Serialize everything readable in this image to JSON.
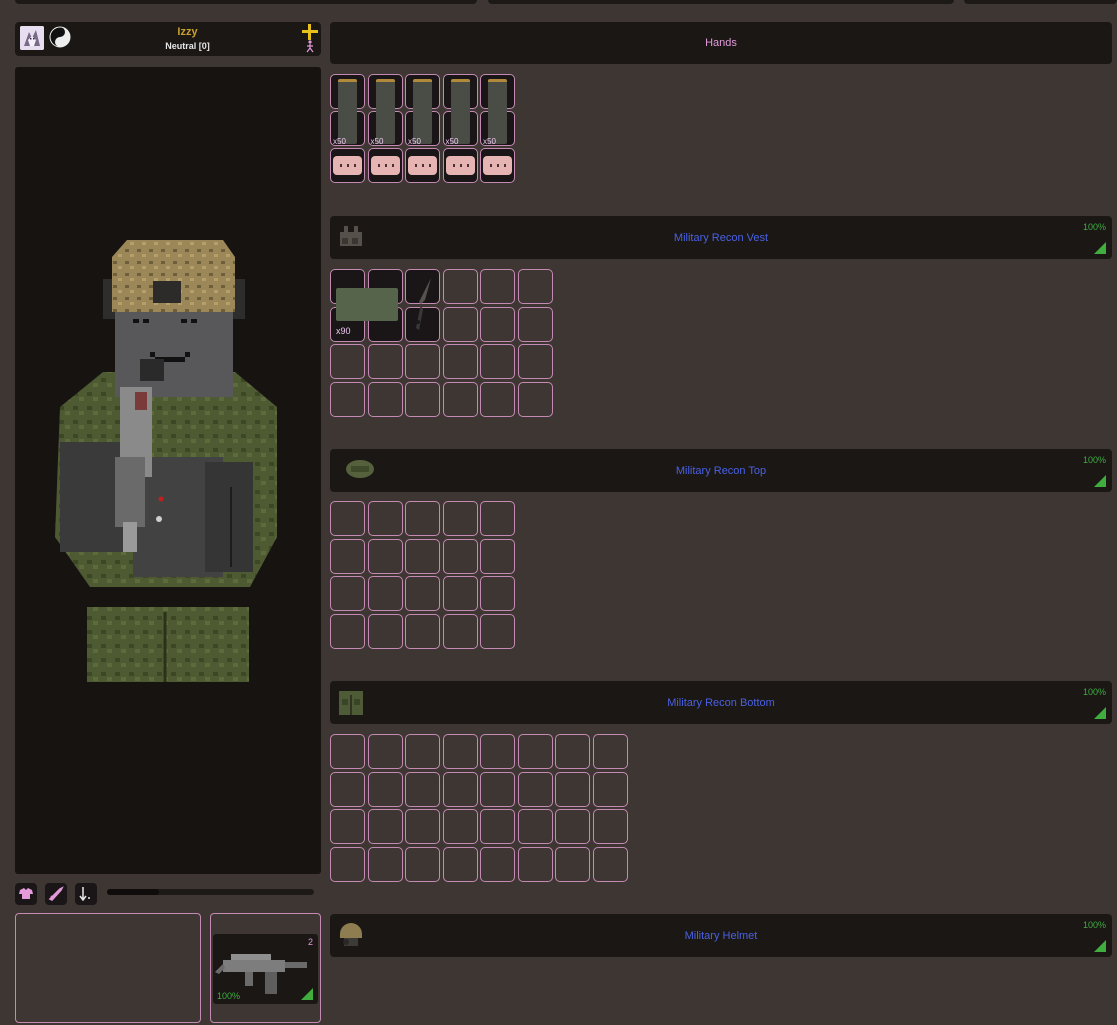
{
  "player": {
    "name": "Izzy",
    "status": "Neutral [0]"
  },
  "hands": {
    "title": "Hands",
    "magazines": [
      {
        "qty": "x50"
      },
      {
        "qty": "x50"
      },
      {
        "qty": "x50"
      },
      {
        "qty": "x50"
      },
      {
        "qty": "x50"
      }
    ],
    "bandage_count": 5
  },
  "vest": {
    "title": "Military Recon Vest",
    "durability": "100%",
    "ammo_qty": "x90"
  },
  "top": {
    "title": "Military Recon Top",
    "durability": "100%"
  },
  "bottom": {
    "title": "Military Recon Bottom",
    "durability": "100%"
  },
  "helmet": {
    "title": "Military Helmet",
    "durability": "100%"
  },
  "weapon": {
    "count": "2",
    "durability": "100%"
  },
  "toolbar": {
    "icons": [
      "clothing-icon",
      "weapon-icon",
      "drop-icon"
    ],
    "slider_fraction": 0.25
  },
  "colors": {
    "background": "#3e3632",
    "panel": "#1a1715",
    "slot_border": "#c58ab4",
    "title_blue": "#4a61e3",
    "title_pink": "#e39bd9",
    "durability_green": "#3fae3f",
    "name_gold": "#c9a12c"
  }
}
